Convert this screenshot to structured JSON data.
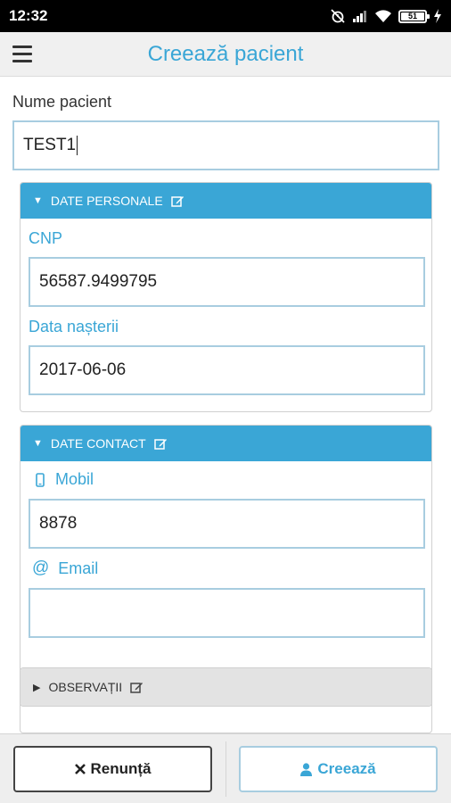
{
  "status_bar": {
    "time": "12:32",
    "battery": "51"
  },
  "app_bar": {
    "title": "Creează pacient"
  },
  "patient": {
    "name_label": "Nume pacient",
    "name_value": "TEST1"
  },
  "personal_panel": {
    "header": "DATE PERSONALE",
    "cnp_label": "CNP",
    "cnp_value": "56587.9499795",
    "birth_label": "Data nașterii",
    "birth_value": "2017-06-06"
  },
  "contact_panel": {
    "header": "DATE CONTACT",
    "mobile_label": "Mobil",
    "mobile_value": "8878",
    "email_label": "Email",
    "email_value": ""
  },
  "observations_panel": {
    "header": "OBSERVAȚII"
  },
  "actions": {
    "cancel_label": "Renunță",
    "create_label": "Creează"
  },
  "colors": {
    "accent": "#3aa6d6",
    "input_border": "#a8cde0",
    "panel_collapsed": "#e3e3e3"
  }
}
